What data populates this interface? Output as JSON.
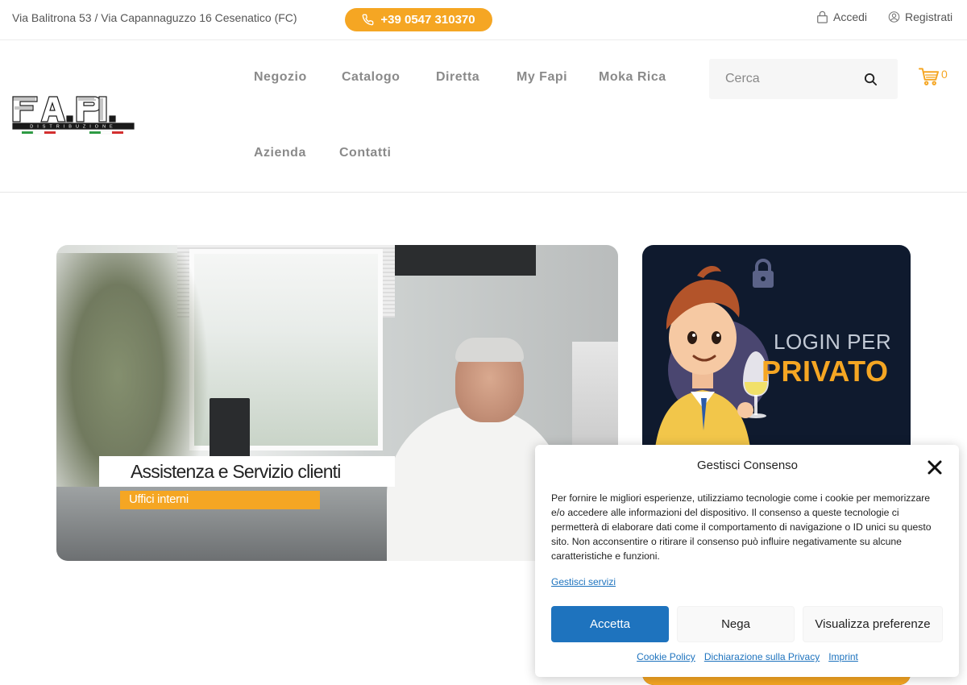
{
  "topbar": {
    "address": "Via Balitrona 53 / Via Capannaguzzo 16 Cesenatico (FC)",
    "phone": "+39 0547 310370",
    "login": "Accedi",
    "register": "Registrati"
  },
  "logo": {
    "text": "FA.PI.",
    "subtitle": "DISTRIBUZIONE"
  },
  "nav": {
    "items": [
      "Negozio",
      "Catalogo",
      "Diretta",
      "My Fapi",
      "Moka Rica",
      "Azienda",
      "Contatti"
    ]
  },
  "search": {
    "placeholder": "Cerca"
  },
  "cart": {
    "count": "0"
  },
  "banner_assistance": {
    "title": "Assistenza e Servizio clienti",
    "subtitle": "Uffici interni"
  },
  "banner_login": {
    "line1": "LOGIN PER",
    "line2": "PRIVATO"
  },
  "cookie": {
    "title": "Gestisci Consenso",
    "body": "Per fornire le migliori esperienze, utilizziamo tecnologie come i cookie per memorizzare e/o accedere alle informazioni del dispositivo. Il consenso a queste tecnologie ci permetterà di elaborare dati come il comportamento di navigazione o ID unici su questo sito. Non acconsentire o ritirare il consenso può influire negativamente su alcune caratteristiche e funzioni.",
    "manage": "Gestisci servizi",
    "accept": "Accetta",
    "deny": "Nega",
    "preferences": "Visualizza preferenze",
    "links": [
      "Cookie Policy",
      "Dichiarazione sulla Privacy",
      "Imprint"
    ]
  },
  "colors": {
    "accent": "#f5a623",
    "link": "#1e73be",
    "dark_banner": "#0f1a2e"
  }
}
